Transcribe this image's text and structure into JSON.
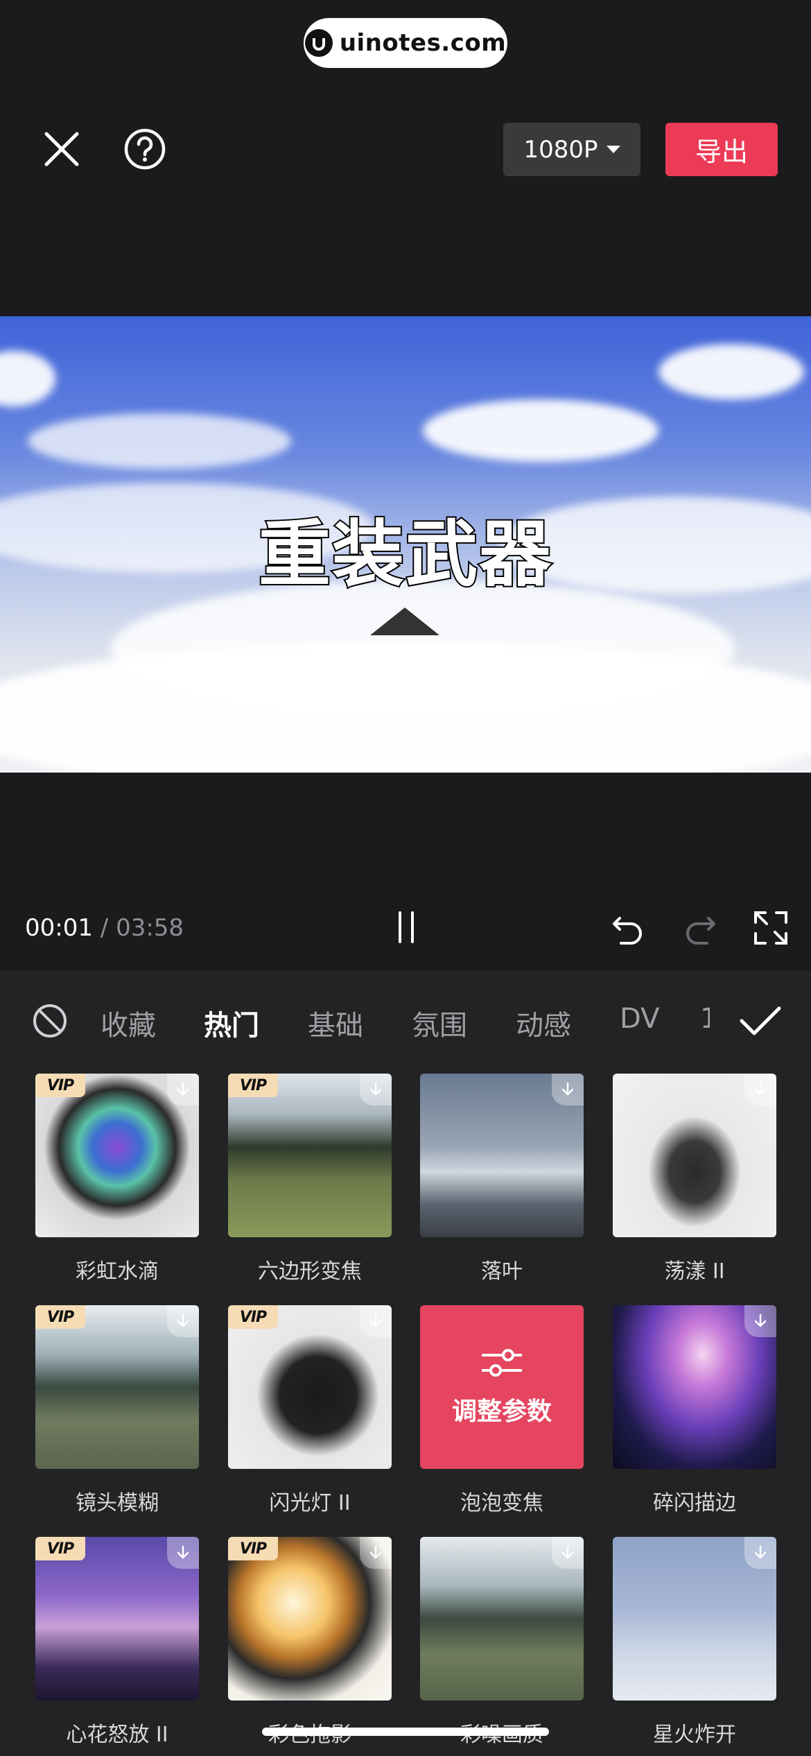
{
  "watermark": {
    "text": "uinotes.com"
  },
  "toolbar": {
    "close_icon": "close-icon",
    "help_icon": "help-icon",
    "resolution": "1080P",
    "export_label": "导出"
  },
  "preview": {
    "title": "重装武器"
  },
  "playback": {
    "current": "00:01",
    "separator": "/",
    "total": "03:58"
  },
  "tabs": [
    {
      "label": "收藏",
      "active": false
    },
    {
      "label": "热门",
      "active": true
    },
    {
      "label": "基础",
      "active": false
    },
    {
      "label": "氛围",
      "active": false
    },
    {
      "label": "动感",
      "active": false
    },
    {
      "label": "DV",
      "active": false
    }
  ],
  "effects": [
    {
      "label": "彩虹水滴",
      "vip": true,
      "download": true
    },
    {
      "label": "六边形变焦",
      "vip": true,
      "download": true
    },
    {
      "label": "落叶",
      "vip": false,
      "download": true
    },
    {
      "label": "荡漾 II",
      "vip": false,
      "download": true
    },
    {
      "label": "镜头模糊",
      "vip": true,
      "download": true
    },
    {
      "label": "闪光灯 II",
      "vip": true,
      "download": true
    },
    {
      "label": "泡泡变焦",
      "vip": false,
      "download": false,
      "selected_overlay": "调整参数"
    },
    {
      "label": "碎闪描边",
      "vip": false,
      "download": true
    },
    {
      "label": "心花怒放 II",
      "vip": true,
      "download": true
    },
    {
      "label": "彩色拖影",
      "vip": true,
      "download": true
    },
    {
      "label": "彩噪画质",
      "vip": false,
      "download": true
    },
    {
      "label": "星火炸开",
      "vip": false,
      "download": true
    }
  ],
  "badge": {
    "vip_text": "VIP"
  },
  "colors": {
    "accent": "#ec3b57",
    "panel": "#232325",
    "background": "#1b1b1d"
  }
}
